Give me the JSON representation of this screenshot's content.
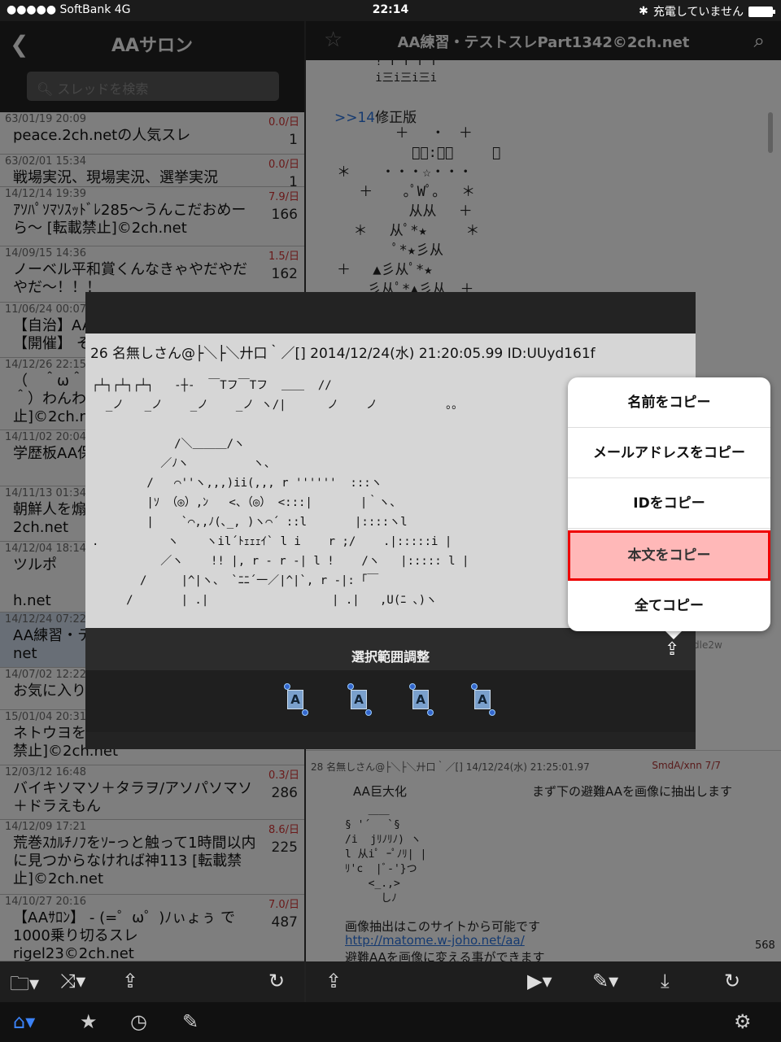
{
  "status": {
    "carrier": "●●●●● SoftBank  4G",
    "time": "22:14",
    "battery_text": "充電していません"
  },
  "left": {
    "title": "AAサロン",
    "search_placeholder": "スレッドを検索",
    "threads": [
      {
        "date": "63/01/19 20:09",
        "rate": "0.0/日",
        "title": "peace.2ch.netの人気スレ",
        "count": "1"
      },
      {
        "date": "63/02/01 15:34",
        "rate": "0.0/日",
        "title": "戦場実況、現場実況、選挙実況",
        "count": "1"
      },
      {
        "date": "14/12/14 19:39",
        "rate": "7.9/日",
        "title": "ｱｿﾊﾟｿﾏｿｽｯﾄﾞﾚ285〜うんこだおめーら〜 [転載禁止]©2ch.net",
        "count": "166"
      },
      {
        "date": "14/09/15 14:36",
        "rate": "1.5/日",
        "title": "ノーベル平和賞くんなきゃやだやだやだ〜！！！",
        "count": "162"
      },
      {
        "date": "11/06/24 00:07",
        "rate": "",
        "title": "【自治】AA\n【開催】 そ",
        "count": ""
      },
      {
        "date": "14/12/26 22:15",
        "rate": "",
        "title": "（　＾ω＾\n＾）わんわ\n止]©2ch.ne",
        "count": ""
      },
      {
        "date": "14/11/02 20:04",
        "rate": "",
        "title": "学歴板AA保",
        "count": ""
      },
      {
        "date": "14/11/13 01:34",
        "rate": "",
        "title": "朝鮮人を煽\n2ch.net",
        "count": ""
      },
      {
        "date": "14/12/04 18:14",
        "rate": "",
        "title": "ツルポ\n\nh.net",
        "count": ""
      },
      {
        "date": "14/12/24 07:22",
        "rate": "",
        "title": "AA練習・テ\nnet",
        "count": ""
      },
      {
        "date": "14/07/02 12:22",
        "rate": "",
        "title": "お気に入り",
        "count": ""
      },
      {
        "date": "15/01/04 20:31",
        "rate": "",
        "title": "ネトウヨを\n禁止]©2ch.net",
        "count": ""
      },
      {
        "date": "12/03/12 16:48",
        "rate": "0.3/日",
        "title": "バイキソマソ＋タラヲ/アソパソマソ＋ドラえもん",
        "count": "286"
      },
      {
        "date": "14/12/09 17:21",
        "rate": "8.6/日",
        "title": "荒巻ｽｶﾙﾁﾉﾌをｿｰっと触って1時間以内に見つからなければ神113 [転載禁止]©2ch.net",
        "count": "225"
      },
      {
        "date": "14/10/27 20:16",
        "rate": "7.0/日",
        "title": "【AAｻﾛﾝ】 - (=゜ω゜)ﾉぃょぅ で1000乗り切るスレrigel23©2ch.net",
        "count": "487"
      }
    ]
  },
  "right": {
    "title": "AA練習・テストスレPart1342©2ch.net",
    "aa_top": "   ! T T T T\n   i三i三i三i",
    "ref": ">>14",
    "ref_text": "修正版",
    "tree": "       ＋　 ・　＋\n         ﾟ｡:｡ﾟ　   ＋\n＊  　・・・☆・・・\n　 ＋　  ｡ﾟWﾟ｡　 ＊\n　　　　  从从 　＋\n  ＊ 　从ﾟ*★　   ＊\n　　　　ﾟ*★彡从\n＋　 ▲彡从ﾟ*★\n 　 彡从ﾟ*▲彡从　＋\n  　从ﾟ*★彡从ﾟ*▲",
    "post28_header": "28 名無しさん@├＼├＼廾口｀／[] 14/12/24(水) 21:25:01.97",
    "post28_id": "SmdA/xnn 7/7",
    "post28_l1": "AA巨大化",
    "post28_l2": "まず下の避難AAを画像に抽出します",
    "post28_aa": "　  ＿＿\n§ '´　 `§\n/i  jﾘﾉﾘﾉ) ヽ\nl 从iﾟ ｰﾟﾉﾘ| |\nﾘ'c  |ﾞ-'}つ\n　  <_.,>\n　    しﾉ",
    "post28_l3": "画像抽出はこのサイトから可能です",
    "post28_link": "http://matome.w-joho.net/aa/",
    "post28_l4": "避難AAを画像に変える事ができます",
    "ps_partial": "dle2w",
    "page_num": "568"
  },
  "modal": {
    "header": "26 名無しさん@├＼├＼廾口｀／[] 2014/12/24(水) 21:20:05.99 ID:UUyd161f",
    "aa": "┌┴┐┌┴┐┌┴┐   -┼-  ￣Tフ￣Tフ  ＿＿  //\n  _ノ   _ノ    _ノ    _ノ ヽ/|      ノ    ノ          。。\n\n            /＼＿＿＿/ヽ\n          ／ﾉヽ　　　　　 ヽ、\n        /   ⌒''ヽ,,,)ii(,,, r ''''''  :::ヽ\n        |ｿ （◎）,ﾝ   <、（◎） <:::|       |｀ヽ、\n        |    `⌒,,ﾉ(､_, )ヽ⌒´ ::l       |::::ヽl\n.          ヽ    ヽil´ﾄｪｪｪｲ` l i    r ;/    .|:::::i |\n          ／ヽ    !! |, r - r -| l !    /ヽ   |::::: l |\n       /     |^|ヽ、 `ﾆﾆ´一／|^|`, r -|: ｢￣\n     /       | .|                  | .|   ,U(ﾆ ､)ヽ",
    "bar_title": "選択範囲調整"
  },
  "menu": [
    "名前をコピー",
    "メールアドレスをコピー",
    "IDをコピー",
    "本文をコピー",
    "全てコピー"
  ]
}
